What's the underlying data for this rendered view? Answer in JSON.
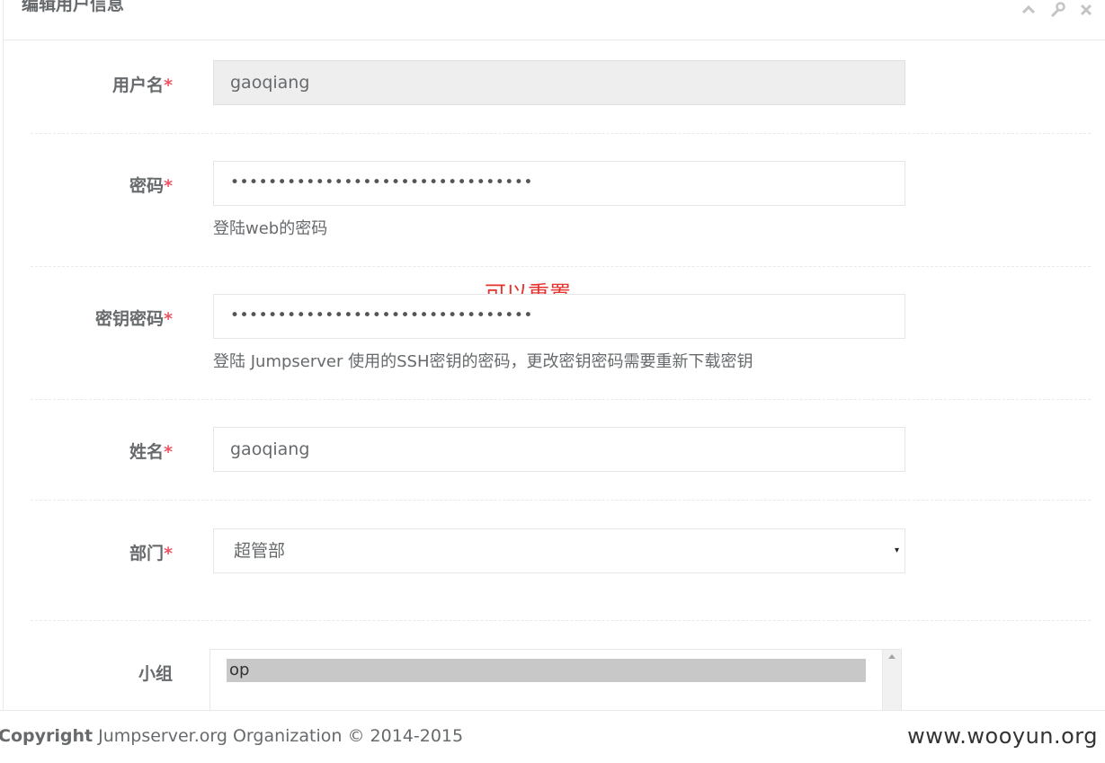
{
  "panel": {
    "title": "编辑用户信息",
    "tools": [
      "chevron-up-icon",
      "wrench-icon",
      "close-icon"
    ]
  },
  "form": {
    "username": {
      "label": "用户名",
      "required": "*",
      "value": "gaoqiang"
    },
    "password": {
      "label": "密码",
      "required": "*",
      "value": "••••••••••••••••••••••••••••••••",
      "help": "登陆web的密码"
    },
    "key_password": {
      "label": "密钥密码",
      "required": "*",
      "value": "••••••••••••••••••••••••••••••••",
      "help": "登陆 Jumpserver 使用的SSH密钥的密码，更改密钥密码需要重新下载密钥"
    },
    "name": {
      "label": "姓名",
      "required": "*",
      "value": "gaoqiang"
    },
    "department": {
      "label": "部门",
      "required": "*",
      "selected": "超管部",
      "arrow": "▾"
    },
    "group": {
      "label": "小组",
      "options": [
        "op"
      ]
    }
  },
  "annotation": "可以重置",
  "footer": {
    "copyright_bold": "Copyright",
    "copyright_rest": " Jumpserver.org Organization © 2014-2015",
    "watermark": "www.wooyun.org"
  },
  "colors": {
    "required": "#ed5565",
    "annotation": "#e8322e",
    "selected_option": "#c8c8c8"
  }
}
